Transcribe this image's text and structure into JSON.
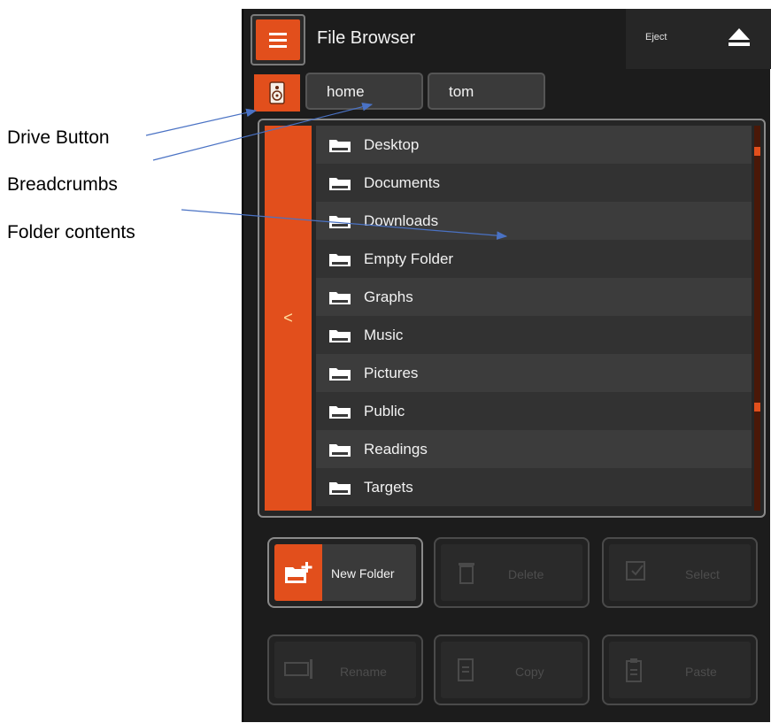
{
  "annotations": {
    "drive_button": "Drive Button",
    "breadcrumbs": "Breadcrumbs",
    "folder_contents": "Folder contents"
  },
  "header": {
    "title": "File Browser",
    "eject_label": "Eject",
    "icons": [
      "menu-icon",
      "eject-icon"
    ]
  },
  "breadcrumbs": [
    "home",
    "tom"
  ],
  "drive_icon": "drive-icon",
  "back_label": "<",
  "folders": [
    "Desktop",
    "Documents",
    "Downloads",
    "Empty Folder",
    "Graphs",
    "Music",
    "Pictures",
    "Public",
    "Readings",
    "Targets"
  ],
  "actions": {
    "new_folder": "New Folder",
    "delete": "Delete",
    "select": "Select",
    "rename": "Rename",
    "copy": "Copy",
    "paste": "Paste"
  },
  "colors": {
    "accent": "#e24f1c",
    "background": "#1c1c1c",
    "row_light": "#3c3c3c",
    "row_dark": "#323232"
  }
}
